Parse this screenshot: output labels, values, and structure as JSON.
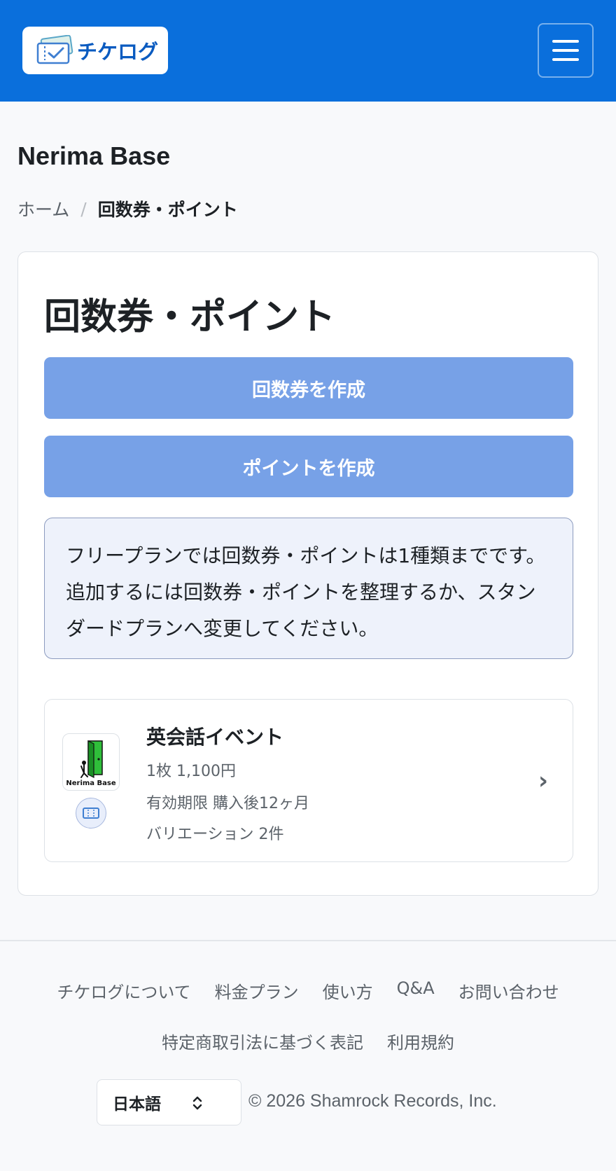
{
  "header": {
    "logo_text": "チケログ",
    "brand_color": "#0a6fdc"
  },
  "page": {
    "org_name": "Nerima Base",
    "breadcrumb": {
      "home": "ホーム",
      "separator": "/",
      "current": "回数券・ポイント"
    }
  },
  "card": {
    "title": "回数券・ポイント",
    "create_ticket_button": "回数券を作成",
    "create_point_button": "ポイントを作成",
    "notice_text": "フリープランでは回数券・ポイントは1種類までです。追加するには回数券・ポイントを整理するか、スタンダードプランへ変更してください。",
    "items": [
      {
        "name": "英会話イベント",
        "price": "1枚 1,100円",
        "expiry": "有効期限 購入後12ヶ月",
        "variations": "バリエーション 2件",
        "thumb_caption": "Nerima Base",
        "type_icon": "ticket-icon"
      }
    ]
  },
  "footer": {
    "links_row1": [
      "チケログについて",
      "料金プラン",
      "使い方",
      "Q&A",
      "お問い合わせ"
    ],
    "links_row2": [
      "特定商取引法に基づく表記",
      "利用規約"
    ],
    "language": "日本語",
    "copyright": "© 2026 Shamrock Records, Inc."
  }
}
